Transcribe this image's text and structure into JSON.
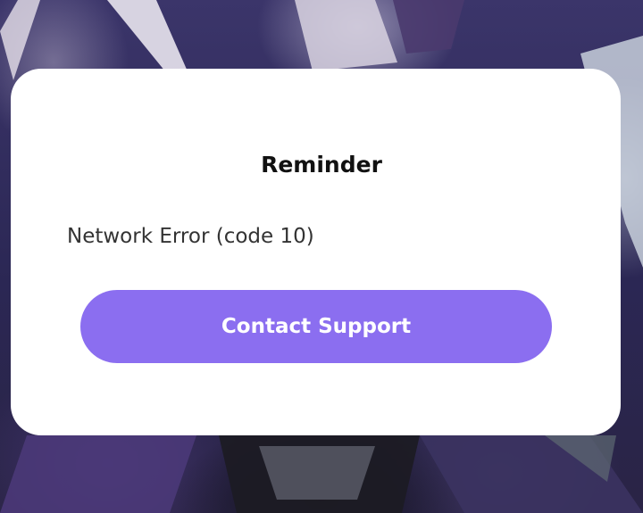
{
  "dialog": {
    "title": "Reminder",
    "message": "Network Error (code 10)",
    "button_label": "Contact Support"
  },
  "colors": {
    "dialog_background": "#ffffff",
    "button_background": "#8b6ef0",
    "button_text": "#ffffff",
    "title_text": "#111111",
    "message_text": "#333333",
    "backdrop": "#2b2754"
  }
}
